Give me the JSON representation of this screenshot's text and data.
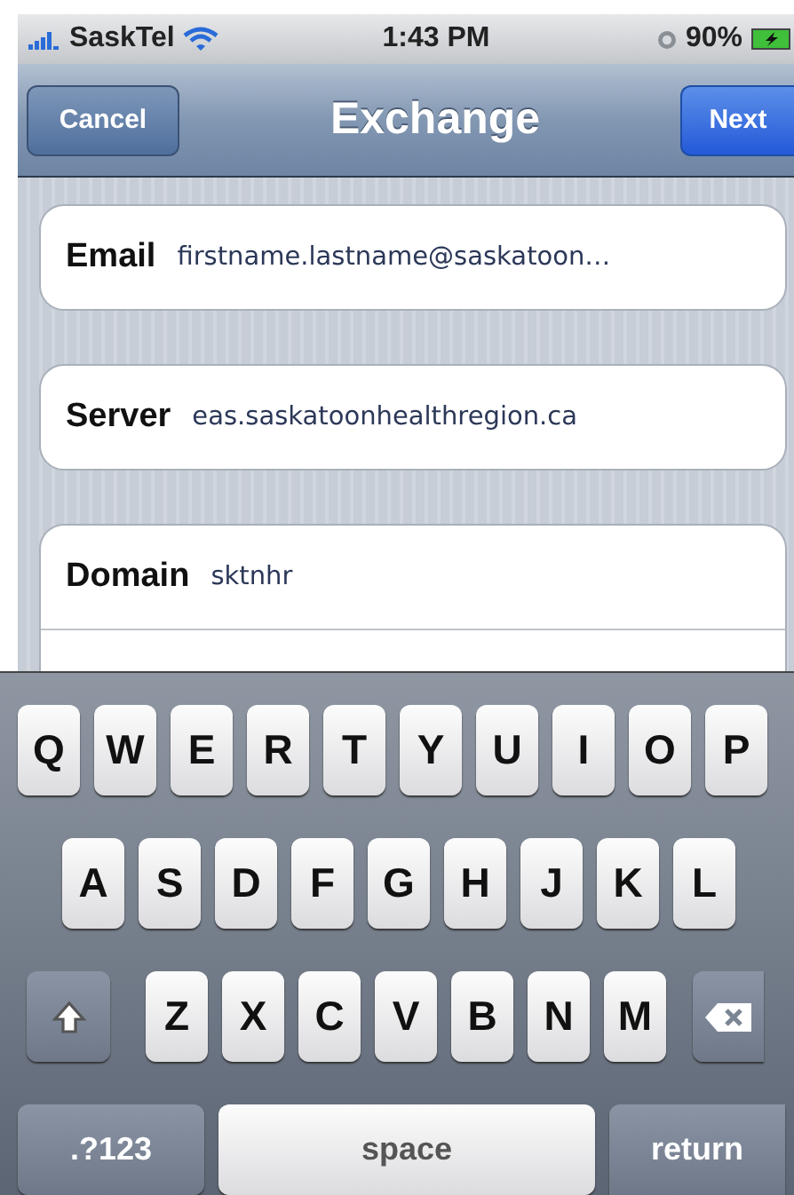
{
  "status_bar": {
    "carrier": "SaskTel",
    "time": "1:43 PM",
    "battery": "90%"
  },
  "nav_bar": {
    "cancel": "Cancel",
    "title": "Exchange",
    "next": "Next"
  },
  "groups": [
    [
      {
        "label": "Email",
        "value": "firstname.lastname@saskatoon…"
      }
    ],
    [
      {
        "label": "Server",
        "value": "eas.saskatoonhealthregion.ca"
      }
    ],
    [
      {
        "label": "Domain",
        "value": "sktnhr"
      }
    ]
  ],
  "keyboard": {
    "rows": [
      [
        {
          "kind": "letter",
          "label": "Q"
        },
        {
          "kind": "letter",
          "label": "W"
        },
        {
          "kind": "letter",
          "label": "E"
        },
        {
          "kind": "letter",
          "label": "R"
        },
        {
          "kind": "letter",
          "label": "T"
        },
        {
          "kind": "letter",
          "label": "Y"
        },
        {
          "kind": "letter",
          "label": "U"
        },
        {
          "kind": "letter",
          "label": "I"
        },
        {
          "kind": "letter",
          "label": "O"
        },
        {
          "kind": "letter",
          "label": "P"
        }
      ],
      [
        {
          "kind": "letter",
          "label": "A"
        },
        {
          "kind": "letter",
          "label": "S"
        },
        {
          "kind": "letter",
          "label": "D"
        },
        {
          "kind": "letter",
          "label": "F"
        },
        {
          "kind": "letter",
          "label": "G"
        },
        {
          "kind": "letter",
          "label": "H"
        },
        {
          "kind": "letter",
          "label": "J"
        },
        {
          "kind": "letter",
          "label": "K"
        },
        {
          "kind": "letter",
          "label": "L"
        }
      ],
      [
        {
          "kind": "shift"
        },
        {
          "kind": "letter",
          "label": "Z"
        },
        {
          "kind": "letter",
          "label": "X"
        },
        {
          "kind": "letter",
          "label": "C"
        },
        {
          "kind": "letter",
          "label": "V"
        },
        {
          "kind": "letter",
          "label": "B"
        },
        {
          "kind": "letter",
          "label": "N"
        },
        {
          "kind": "letter",
          "label": "M"
        },
        {
          "kind": "delete"
        }
      ]
    ],
    "bottom_bar": [
      {
        "kind": "mode",
        "label": ".?123"
      },
      {
        "kind": "space",
        "label": "space"
      },
      {
        "kind": "return",
        "label": "return"
      }
    ]
  }
}
